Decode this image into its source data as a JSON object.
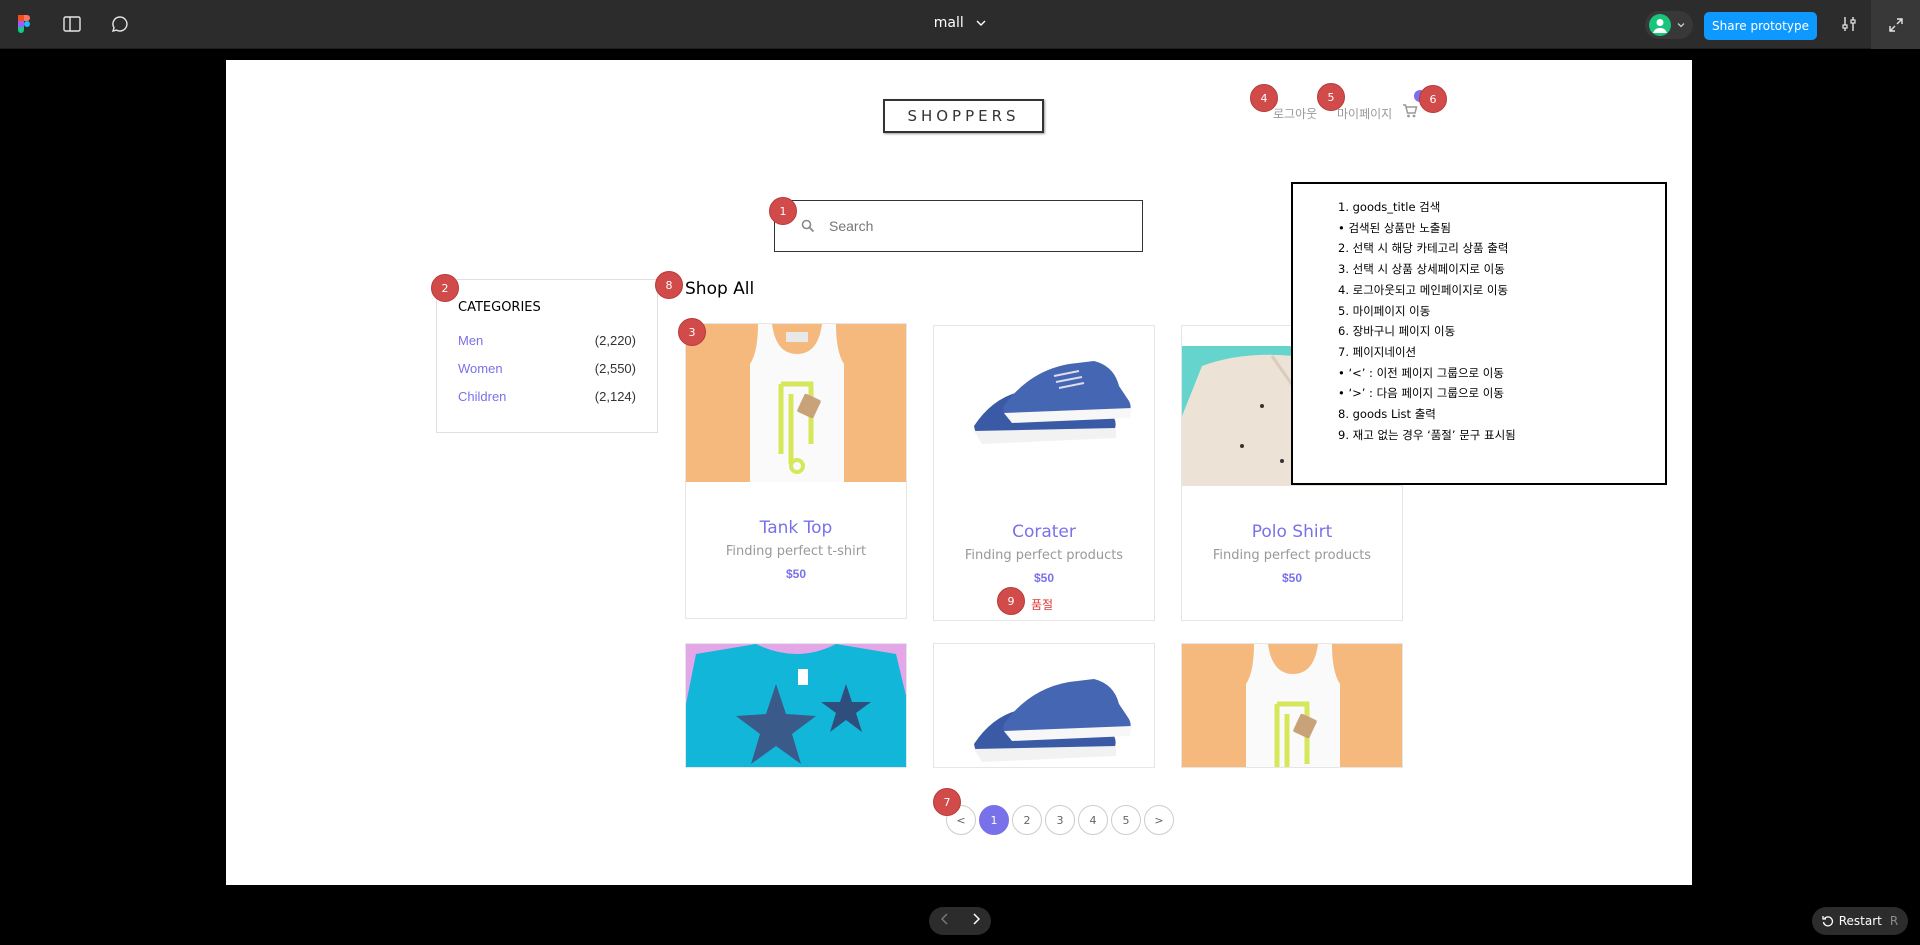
{
  "toolbar": {
    "file_name": "mall",
    "share_label": "Share prototype"
  },
  "header": {
    "logo": "SHOPPERS",
    "logout_label": "로그아웃",
    "mypage_label": "마이페이지"
  },
  "search": {
    "placeholder": "Search"
  },
  "categories": {
    "title": "CATEGORIES",
    "items": [
      {
        "name": "Men",
        "count": "(2,220)"
      },
      {
        "name": "Women",
        "count": "(2,550)"
      },
      {
        "name": "Children",
        "count": "(2,124)"
      }
    ]
  },
  "shop": {
    "title": "Shop All",
    "products": [
      {
        "name": "Tank Top",
        "desc": "Finding perfect t-shirt",
        "price": "$50",
        "image": "tank-top"
      },
      {
        "name": "Corater",
        "desc": "Finding perfect products",
        "price": "$50",
        "image": "blue-sneakers",
        "badge": "품절"
      },
      {
        "name": "Polo Shirt",
        "desc": "Finding perfect products",
        "price": "$50",
        "image": "polo-shirt"
      },
      {
        "image": "blue-tshirt"
      },
      {
        "image": "blue-sneakers"
      },
      {
        "image": "tank-top"
      }
    ]
  },
  "pagination": {
    "prev": "<",
    "pages": [
      "1",
      "2",
      "3",
      "4",
      "5"
    ],
    "next": ">",
    "active": "1"
  },
  "annotation_markers": [
    "1",
    "2",
    "3",
    "4",
    "5",
    "6",
    "7",
    "8",
    "9"
  ],
  "notes": [
    "1. goods_title 검색",
    "• 검색된 상품만 노출됨",
    "2. 선택 시 해당 카테고리 상품 출력",
    "3. 선택 시 상품 상세페이지로 이동",
    "4. 로그아웃되고 메인페이지로 이동",
    "5. 마이페이지 이동",
    "6. 장바구니 페이지 이동",
    "7. 페이지네이션",
    "• ‘<’ : 이전 페이지 그룹으로 이동",
    "• ‘>’ : 다음 페이지 그룹으로 이동",
    "8. goods List 출력",
    "9. 재고 없는 경우 ‘품절’ 문구 표시됨"
  ],
  "footer": {
    "restart_label": "Restart",
    "restart_key": "R"
  },
  "colors": {
    "accent": "#7971ea",
    "marker": "#d14b4b",
    "figma_blue": "#0d99ff",
    "soldout": "#e03535"
  }
}
